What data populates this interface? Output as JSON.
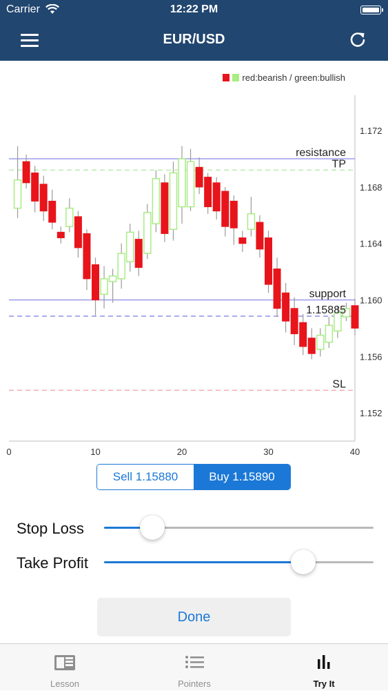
{
  "status_bar": {
    "carrier": "Carrier",
    "time": "12:22 PM"
  },
  "nav": {
    "title": "EUR/USD",
    "left_icon": "hamburger-menu-icon",
    "right_icon": "refresh-icon"
  },
  "chart_data": {
    "type": "candlestick",
    "legend": {
      "text": "red:bearish / green:bullish",
      "bearish_color": "#e8141b",
      "bullish_color": "#a9ec84",
      "placement": "top-right"
    },
    "x": {
      "range": [
        0,
        40
      ],
      "ticks": [
        0,
        10,
        20,
        30,
        40
      ]
    },
    "y": {
      "range": [
        1.15,
        1.1745
      ],
      "ticks": [
        1.152,
        1.156,
        1.16,
        1.164,
        1.168,
        1.172
      ],
      "tick_labels": [
        "1.152",
        "1.156",
        "1.160",
        "1.164",
        "1.168",
        "1.172"
      ],
      "position": "right"
    },
    "candles": [
      {
        "x": 1,
        "open": 1.1665,
        "close": 1.1685,
        "high": 1.1709,
        "low": 1.1658
      },
      {
        "x": 2,
        "open": 1.1698,
        "close": 1.1683,
        "high": 1.1703,
        "low": 1.1679
      },
      {
        "x": 3,
        "open": 1.169,
        "close": 1.167,
        "high": 1.1695,
        "low": 1.1662
      },
      {
        "x": 4,
        "open": 1.1682,
        "close": 1.1663,
        "high": 1.1688,
        "low": 1.1656
      },
      {
        "x": 5,
        "open": 1.167,
        "close": 1.1655,
        "high": 1.1678,
        "low": 1.165
      },
      {
        "x": 6,
        "open": 1.1648,
        "close": 1.1644,
        "high": 1.1652,
        "low": 1.164
      },
      {
        "x": 7,
        "open": 1.1652,
        "close": 1.1665,
        "high": 1.1672,
        "low": 1.1648
      },
      {
        "x": 8,
        "open": 1.1659,
        "close": 1.1637,
        "high": 1.1663,
        "low": 1.163
      },
      {
        "x": 9,
        "open": 1.1647,
        "close": 1.1615,
        "high": 1.165,
        "low": 1.1607
      },
      {
        "x": 10,
        "open": 1.1625,
        "close": 1.16,
        "high": 1.163,
        "low": 1.1589
      },
      {
        "x": 11,
        "open": 1.1604,
        "close": 1.1615,
        "high": 1.1624,
        "low": 1.1594
      },
      {
        "x": 12,
        "open": 1.1613,
        "close": 1.1617,
        "high": 1.1622,
        "low": 1.1598
      },
      {
        "x": 13,
        "open": 1.1615,
        "close": 1.1633,
        "high": 1.164,
        "low": 1.1608
      },
      {
        "x": 14,
        "open": 1.1627,
        "close": 1.1648,
        "high": 1.1654,
        "low": 1.162
      },
      {
        "x": 15,
        "open": 1.1643,
        "close": 1.1623,
        "high": 1.1649,
        "low": 1.1617
      },
      {
        "x": 16,
        "open": 1.1633,
        "close": 1.1662,
        "high": 1.1668,
        "low": 1.1629
      },
      {
        "x": 17,
        "open": 1.1654,
        "close": 1.1686,
        "high": 1.1692,
        "low": 1.1648
      },
      {
        "x": 18,
        "open": 1.1683,
        "close": 1.1647,
        "high": 1.1689,
        "low": 1.1641
      },
      {
        "x": 19,
        "open": 1.165,
        "close": 1.169,
        "high": 1.1698,
        "low": 1.1642
      },
      {
        "x": 20,
        "open": 1.1666,
        "close": 1.17,
        "high": 1.1709,
        "low": 1.1654
      },
      {
        "x": 21,
        "open": 1.1666,
        "close": 1.1698,
        "high": 1.1707,
        "low": 1.1663
      },
      {
        "x": 22,
        "open": 1.1694,
        "close": 1.168,
        "high": 1.1701,
        "low": 1.1675
      },
      {
        "x": 23,
        "open": 1.1687,
        "close": 1.1666,
        "high": 1.169,
        "low": 1.1661
      },
      {
        "x": 24,
        "open": 1.1683,
        "close": 1.1663,
        "high": 1.1687,
        "low": 1.1657
      },
      {
        "x": 25,
        "open": 1.1677,
        "close": 1.1652,
        "high": 1.168,
        "low": 1.1645
      },
      {
        "x": 26,
        "open": 1.167,
        "close": 1.1651,
        "high": 1.1674,
        "low": 1.1639
      },
      {
        "x": 27,
        "open": 1.1644,
        "close": 1.164,
        "high": 1.1649,
        "low": 1.1634
      },
      {
        "x": 28,
        "open": 1.165,
        "close": 1.1661,
        "high": 1.1673,
        "low": 1.1645
      },
      {
        "x": 29,
        "open": 1.1655,
        "close": 1.1636,
        "high": 1.166,
        "low": 1.163
      },
      {
        "x": 30,
        "open": 1.1644,
        "close": 1.1611,
        "high": 1.1649,
        "low": 1.1605
      },
      {
        "x": 31,
        "open": 1.1622,
        "close": 1.1594,
        "high": 1.163,
        "low": 1.1588
      },
      {
        "x": 32,
        "open": 1.1605,
        "close": 1.1585,
        "high": 1.1612,
        "low": 1.1577
      },
      {
        "x": 33,
        "open": 1.1594,
        "close": 1.1576,
        "high": 1.1602,
        "low": 1.1568
      },
      {
        "x": 34,
        "open": 1.1584,
        "close": 1.1567,
        "high": 1.159,
        "low": 1.1561
      },
      {
        "x": 35,
        "open": 1.1573,
        "close": 1.1562,
        "high": 1.158,
        "low": 1.1558
      },
      {
        "x": 36,
        "open": 1.1565,
        "close": 1.1575,
        "high": 1.158,
        "low": 1.156
      },
      {
        "x": 37,
        "open": 1.157,
        "close": 1.1582,
        "high": 1.1588,
        "low": 1.1566
      },
      {
        "x": 38,
        "open": 1.1578,
        "close": 1.1591,
        "high": 1.1596,
        "low": 1.1573
      },
      {
        "x": 39,
        "open": 1.1588,
        "close": 1.1594,
        "high": 1.1598,
        "low": 1.1585
      },
      {
        "x": 40,
        "open": 1.1596,
        "close": 1.158,
        "high": 1.1601,
        "low": 1.1575
      }
    ],
    "levels": [
      {
        "label": "resistance",
        "value": 1.17,
        "color": "#8a8ae8",
        "style": "solid"
      },
      {
        "label": "TP",
        "value": 1.1692,
        "color": "#a9e8a0",
        "style": "dashed"
      },
      {
        "label": "support",
        "value": 1.16,
        "color": "#8a8ae8",
        "style": "solid"
      },
      {
        "label": "1.15885",
        "value": 1.15885,
        "color": "#7a7ae0",
        "style": "dashed"
      },
      {
        "label": "SL",
        "value": 1.1536,
        "color": "#f0a0a8",
        "style": "dashed"
      }
    ]
  },
  "trade": {
    "sell_label": "Sell 1.15880",
    "buy_label": "Buy 1.15890",
    "selected": "buy"
  },
  "sliders": {
    "stop_loss": {
      "label": "Stop Loss",
      "value": 0.18
    },
    "take_profit": {
      "label": "Take Profit",
      "value": 0.74
    }
  },
  "done_label": "Done",
  "tabs": [
    {
      "label": "Lesson",
      "icon": "book-icon",
      "active": false
    },
    {
      "label": "Pointers",
      "icon": "list-icon",
      "active": false
    },
    {
      "label": "Try It",
      "icon": "bar-chart-icon",
      "active": true
    }
  ],
  "colors": {
    "nav_bg": "#21466f",
    "accent": "#1b78d6"
  }
}
